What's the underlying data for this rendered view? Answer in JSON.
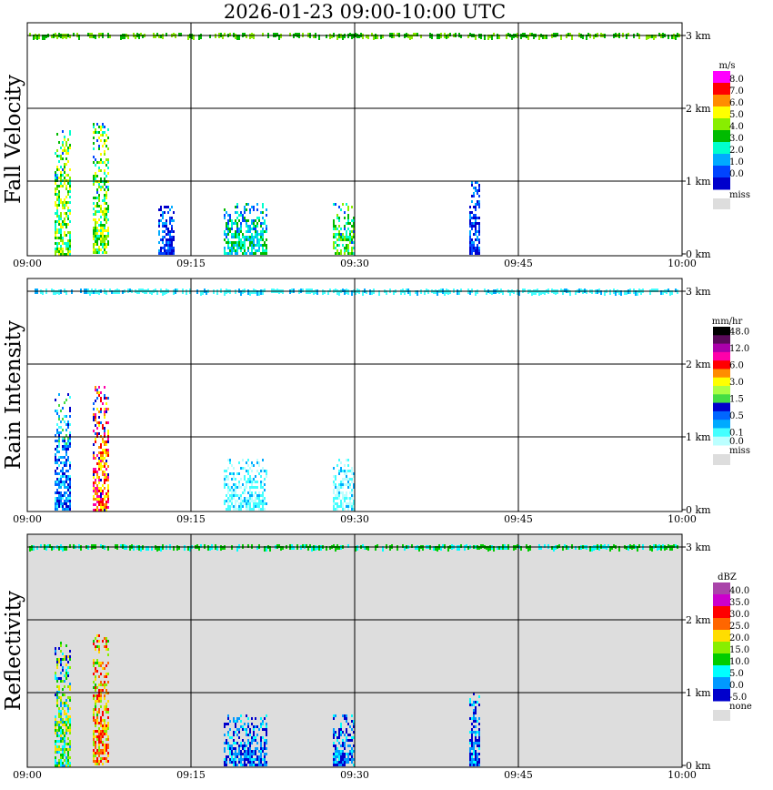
{
  "title": "2026-01-23   09:00-10:00 UTC",
  "x_ticks": [
    "09:00",
    "09:15",
    "09:30",
    "09:45",
    "10:00"
  ],
  "y_ticks": [
    "0 km",
    "1 km",
    "2 km",
    "3 km"
  ],
  "colors": {
    "missing": "#dddddd",
    "grid": "#000000"
  },
  "chart_data": [
    {
      "type": "heatmap",
      "ylabel": "Fall Velocity",
      "xlim": [
        "09:00",
        "10:00"
      ],
      "ylim_km": [
        0,
        3
      ],
      "background": "#ffffff",
      "colorbar": {
        "unit": "m/s",
        "levels": [
          {
            "label": "8.0",
            "color": "#ff00ff"
          },
          {
            "label": "7.0",
            "color": "#ff0000"
          },
          {
            "label": "6.0",
            "color": "#ff8c00"
          },
          {
            "label": "5.0",
            "color": "#ffff00"
          },
          {
            "label": "4.0",
            "color": "#88ee00"
          },
          {
            "label": "3.0",
            "color": "#00bb00"
          },
          {
            "label": "2.0",
            "color": "#00ffcc"
          },
          {
            "label": "1.0",
            "color": "#00aaff"
          },
          {
            "label": "0.0",
            "color": "#0044ff"
          },
          {
            "label": "",
            "color": "#0000cc"
          }
        ],
        "missing_label": "miss"
      },
      "features": [
        {
          "t_start": "09:02.5",
          "t_end": "09:04",
          "z_top_km": 1.7,
          "dominant": "green/yellow"
        },
        {
          "t_start": "09:06",
          "t_end": "09:07.5",
          "z_top_km": 1.8,
          "dominant": "green/yellow"
        },
        {
          "t_start": "09:12",
          "t_end": "09:13.5",
          "z_top_km": 0.7,
          "dominant": "blue"
        },
        {
          "t_start": "09:18",
          "t_end": "09:22",
          "z_top_km": 0.7,
          "dominant": "cyan/green"
        },
        {
          "t_start": "09:28",
          "t_end": "09:30",
          "z_top_km": 0.7,
          "dominant": "green"
        },
        {
          "t_start": "09:40.5",
          "t_end": "09:41.5",
          "z_top_km": 1.0,
          "dominant": "blue"
        }
      ]
    },
    {
      "type": "heatmap",
      "ylabel": "Rain Intensity",
      "xlim": [
        "09:00",
        "10:00"
      ],
      "ylim_km": [
        0,
        3
      ],
      "background": "#ffffff",
      "colorbar": {
        "unit": "mm/hr",
        "levels": [
          {
            "label": "48.0",
            "color": "#000000"
          },
          {
            "label": "",
            "color": "#5a0a5a"
          },
          {
            "label": "12.0",
            "color": "#aa00aa"
          },
          {
            "label": "",
            "color": "#ff00aa"
          },
          {
            "label": "6.0",
            "color": "#ff0000"
          },
          {
            "label": "",
            "color": "#ff8c00"
          },
          {
            "label": "3.0",
            "color": "#ffff00"
          },
          {
            "label": "",
            "color": "#aaff44"
          },
          {
            "label": "1.5",
            "color": "#44dd44"
          },
          {
            "label": "",
            "color": "#0000cc"
          },
          {
            "label": "0.5",
            "color": "#0066ff"
          },
          {
            "label": "",
            "color": "#00aaff"
          },
          {
            "label": "0.1",
            "color": "#44ffff"
          },
          {
            "label": "0.0",
            "color": "#bbffff"
          }
        ],
        "missing_label": "miss"
      },
      "features": [
        {
          "t_start": "09:02.5",
          "t_end": "09:04",
          "z_top_km": 1.6,
          "dominant": "blue/cyan"
        },
        {
          "t_start": "09:06",
          "t_end": "09:07.5",
          "z_top_km": 1.7,
          "dominant": "red/magenta"
        },
        {
          "t_start": "09:18",
          "t_end": "09:22",
          "z_top_km": 0.7,
          "dominant": "cyan"
        },
        {
          "t_start": "09:28",
          "t_end": "09:30",
          "z_top_km": 0.7,
          "dominant": "cyan"
        }
      ]
    },
    {
      "type": "heatmap",
      "ylabel": "Reflectivity",
      "xlim": [
        "09:00",
        "10:00"
      ],
      "ylim_km": [
        0,
        3
      ],
      "background": "#dddddd",
      "colorbar": {
        "unit": "dBZ",
        "levels": [
          {
            "label": "40.0",
            "color": "#aa44aa"
          },
          {
            "label": "35.0",
            "color": "#cc00cc"
          },
          {
            "label": "30.0",
            "color": "#ff0000"
          },
          {
            "label": "25.0",
            "color": "#ff6600"
          },
          {
            "label": "20.0",
            "color": "#ffdd00"
          },
          {
            "label": "15.0",
            "color": "#88ee00"
          },
          {
            "label": "10.0",
            "color": "#00cc00"
          },
          {
            "label": "5.0",
            "color": "#00ffff"
          },
          {
            "label": "0.0",
            "color": "#0099ff"
          },
          {
            "label": "-5.0",
            "color": "#0000cc"
          }
        ],
        "missing_label": "none"
      },
      "features": [
        {
          "t_start": "09:02.5",
          "t_end": "09:04",
          "z_top_km": 1.7,
          "dominant": "green/yellow"
        },
        {
          "t_start": "09:06",
          "t_end": "09:07.5",
          "z_top_km": 1.8,
          "dominant": "red/orange"
        },
        {
          "t_start": "09:18",
          "t_end": "09:22",
          "z_top_km": 0.7,
          "dominant": "blue"
        },
        {
          "t_start": "09:28",
          "t_end": "09:30",
          "z_top_km": 0.7,
          "dominant": "blue"
        },
        {
          "t_start": "09:40.5",
          "t_end": "09:41.5",
          "z_top_km": 1.0,
          "dominant": "blue"
        }
      ]
    }
  ]
}
